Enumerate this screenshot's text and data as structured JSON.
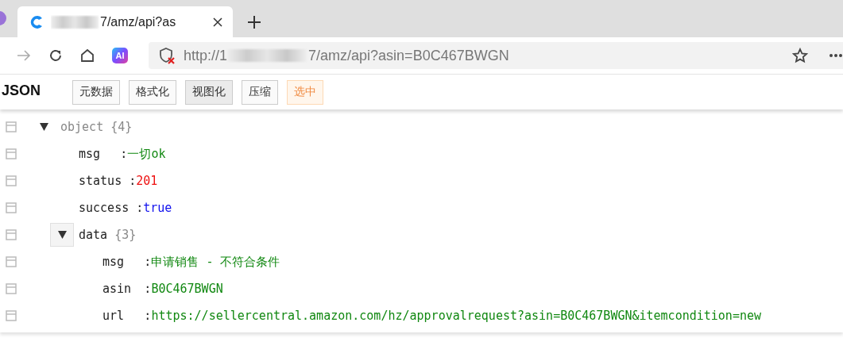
{
  "browser": {
    "tab": {
      "title": "7/amz/api?as"
    },
    "ai_badge": "AI",
    "address": {
      "prefix": "http://1",
      "suffix": "7/amz/api?asin=B0C467BWGN"
    }
  },
  "viewer": {
    "title": "JSON",
    "buttons": [
      {
        "label": "元数据",
        "selected": false,
        "kind": "plain"
      },
      {
        "label": "格式化",
        "selected": false,
        "kind": "plain"
      },
      {
        "label": "视图化",
        "selected": true,
        "kind": "plain"
      },
      {
        "label": "压缩",
        "selected": false,
        "kind": "plain"
      },
      {
        "label": "选中",
        "selected": false,
        "kind": "accent"
      }
    ],
    "tree": {
      "label": "object",
      "kind": "object",
      "count": "{4}",
      "expanded": true,
      "hovered": false,
      "children": [
        {
          "key": "msg",
          "separator": ":",
          "kind": "string",
          "value": "一切ok"
        },
        {
          "key": "status",
          "separator": ":",
          "kind": "number",
          "value": "201"
        },
        {
          "key": "success",
          "separator": ":",
          "kind": "boolean",
          "value": "true"
        },
        {
          "key": "data",
          "kind": "object",
          "count": "{3}",
          "expanded": true,
          "hovered": true,
          "children": [
            {
              "key": "msg",
              "separator": ":",
              "kind": "string",
              "value": "申请销售 - 不符合条件"
            },
            {
              "key": "asin",
              "separator": ":",
              "kind": "string",
              "value": "B0C467BWGN"
            },
            {
              "key": "url",
              "separator": ":",
              "kind": "string",
              "value": "https://sellercentral.amazon.com/hz/approvalrequest?asin=B0C467BWGN&itemcondition=new"
            }
          ]
        }
      ]
    }
  }
}
